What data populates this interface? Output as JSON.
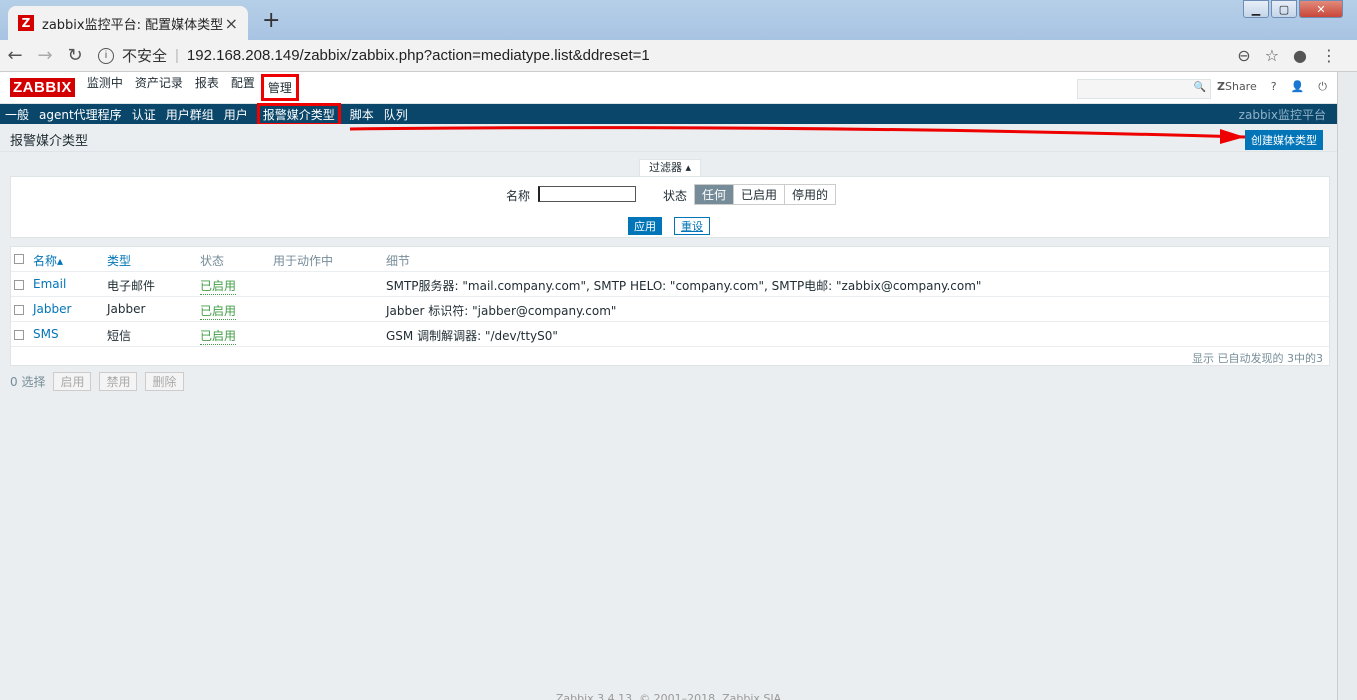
{
  "browser": {
    "tab_title": "zabbix监控平台: 配置媒体类型",
    "tab_close": "×",
    "new_tab": "+",
    "security": "不安全",
    "url": "192.168.208.149/zabbix/zabbix.php?action=mediatype.list&ddreset=1"
  },
  "header": {
    "logo": "ZABBIX",
    "menu": [
      "监测中",
      "资产记录",
      "报表",
      "配置",
      "管理"
    ],
    "share": "Share",
    "help": "?"
  },
  "subnav": {
    "items": [
      "一般",
      "agent代理程序",
      "认证",
      "用户群组",
      "用户",
      "报警媒介类型",
      "脚本",
      "队列"
    ],
    "brand": "zabbix监控平台"
  },
  "page": {
    "title": "报警媒介类型",
    "create_button": "创建媒体类型"
  },
  "filter": {
    "tab": "过滤器 ▴",
    "name_label": "名称",
    "name_value": "",
    "status_label": "状态",
    "status_options": [
      "任何",
      "已启用",
      "停用的"
    ],
    "status_selected": "任何",
    "apply": "应用",
    "reset": "重设"
  },
  "table": {
    "headers": {
      "name": "名称▴",
      "type": "类型",
      "status": "状态",
      "used": "用于动作中",
      "details": "细节"
    },
    "rows": [
      {
        "name": "Email",
        "type": "电子邮件",
        "status": "已启用",
        "details": "SMTP服务器: \"mail.company.com\", SMTP HELO: \"company.com\", SMTP电邮: \"zabbix@company.com\""
      },
      {
        "name": "Jabber",
        "type": "Jabber",
        "status": "已启用",
        "details": "Jabber 标识符: \"jabber@company.com\""
      },
      {
        "name": "SMS",
        "type": "短信",
        "status": "已启用",
        "details": "GSM 调制解调器: \"/dev/ttyS0\""
      }
    ],
    "footnote": "显示 已自动发现的 3中的3"
  },
  "actions": {
    "selected": "0 选择",
    "enable": "启用",
    "disable": "禁用",
    "delete": "删除"
  },
  "footer": "Zabbix 3.4.13. © 2001–2018, Zabbix SIA"
}
